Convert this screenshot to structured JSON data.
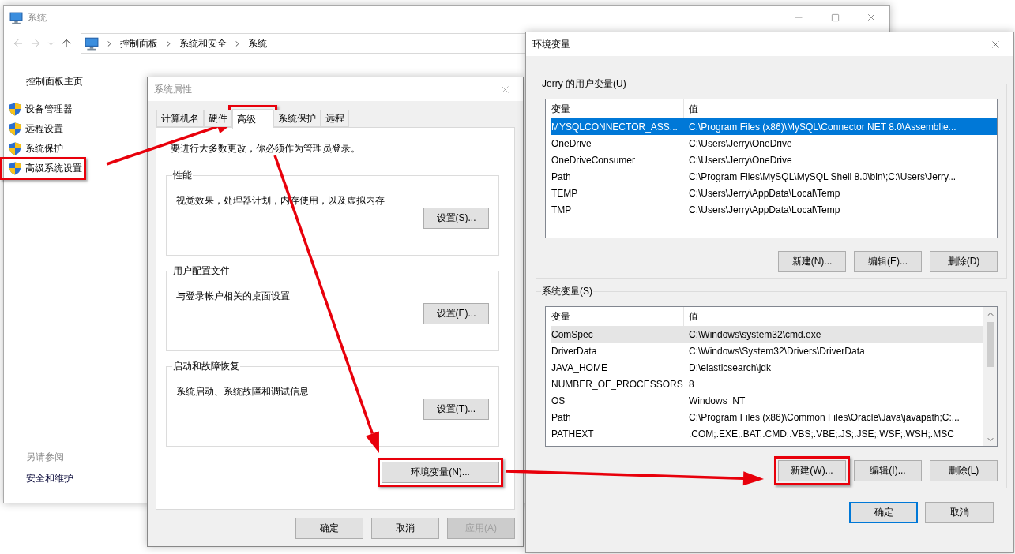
{
  "system_window": {
    "title": "系统",
    "active": false,
    "breadcrumb": [
      "控制面板",
      "系统和安全",
      "系统"
    ],
    "sidebar": {
      "home": "控制面板主页",
      "links": [
        {
          "label": "设备管理器",
          "highlighted": false
        },
        {
          "label": "远程设置",
          "highlighted": false
        },
        {
          "label": "系统保护",
          "highlighted": false
        },
        {
          "label": "高级系统设置",
          "highlighted": true
        }
      ],
      "see_also_heading": "另请参阅",
      "see_also": [
        "安全和维护"
      ]
    }
  },
  "system_properties": {
    "title": "系统属性",
    "active": false,
    "tabs": [
      {
        "label": "计算机名",
        "selected": false,
        "highlighted": false
      },
      {
        "label": "硬件",
        "selected": false,
        "highlighted": false
      },
      {
        "label": "高级",
        "selected": true,
        "highlighted": true
      },
      {
        "label": "系统保护",
        "selected": false,
        "highlighted": false
      },
      {
        "label": "远程",
        "selected": false,
        "highlighted": false
      }
    ],
    "notice": "要进行大多数更改，你必须作为管理员登录。",
    "groups": [
      {
        "title": "性能",
        "description": "视觉效果，处理器计划，内存使用，以及虚拟内存",
        "button": "设置(S)..."
      },
      {
        "title": "用户配置文件",
        "description": "与登录帐户相关的桌面设置",
        "button": "设置(E)..."
      },
      {
        "title": "启动和故障恢复",
        "description": "系统启动、系统故障和调试信息",
        "button": "设置(T)..."
      }
    ],
    "env_button": {
      "label": "环境变量(N)...",
      "highlighted": true
    },
    "buttons": [
      {
        "label": "确定",
        "disabled": false
      },
      {
        "label": "取消",
        "disabled": false
      },
      {
        "label": "应用(A)",
        "disabled": true
      }
    ]
  },
  "environment_variables": {
    "title": "环境变量",
    "active": true,
    "sections": [
      {
        "title": "Jerry 的用户变量(U)",
        "columns": [
          "变量",
          "值"
        ],
        "focused": true,
        "scrollable": false,
        "rows": [
          {
            "name": "MYSQLCONNECTOR_ASS...",
            "value": "C:\\Program Files (x86)\\MySQL\\Connector NET 8.0\\Assemblie...",
            "selected": true
          },
          {
            "name": "OneDrive",
            "value": "C:\\Users\\Jerry\\OneDrive",
            "selected": false
          },
          {
            "name": "OneDriveConsumer",
            "value": "C:\\Users\\Jerry\\OneDrive",
            "selected": false
          },
          {
            "name": "Path",
            "value": "C:\\Program Files\\MySQL\\MySQL Shell 8.0\\bin\\;C:\\Users\\Jerry...",
            "selected": false
          },
          {
            "name": "TEMP",
            "value": "C:\\Users\\Jerry\\AppData\\Local\\Temp",
            "selected": false
          },
          {
            "name": "TMP",
            "value": "C:\\Users\\Jerry\\AppData\\Local\\Temp",
            "selected": false
          }
        ],
        "buttons": [
          {
            "label": "新建(N)...",
            "highlighted": false
          },
          {
            "label": "编辑(E)...",
            "highlighted": false
          },
          {
            "label": "删除(D)",
            "highlighted": false
          }
        ]
      },
      {
        "title": "系统变量(S)",
        "columns": [
          "变量",
          "值"
        ],
        "focused": false,
        "scrollable": true,
        "rows": [
          {
            "name": "ComSpec",
            "value": "C:\\Windows\\system32\\cmd.exe",
            "selected": true
          },
          {
            "name": "DriverData",
            "value": "C:\\Windows\\System32\\Drivers\\DriverData",
            "selected": false
          },
          {
            "name": "JAVA_HOME",
            "value": "D:\\elasticsearch\\jdk",
            "selected": false
          },
          {
            "name": "NUMBER_OF_PROCESSORS",
            "value": "8",
            "selected": false
          },
          {
            "name": "OS",
            "value": "Windows_NT",
            "selected": false
          },
          {
            "name": "Path",
            "value": "C:\\Program Files (x86)\\Common Files\\Oracle\\Java\\javapath;C:...",
            "selected": false
          },
          {
            "name": "PATHEXT",
            "value": ".COM;.EXE;.BAT;.CMD;.VBS;.VBE;.JS;.JSE;.WSF;.WSH;.MSC",
            "selected": false
          }
        ],
        "buttons": [
          {
            "label": "新建(W)...",
            "highlighted": true
          },
          {
            "label": "编辑(I)...",
            "highlighted": false
          },
          {
            "label": "删除(L)",
            "highlighted": false
          }
        ]
      }
    ],
    "buttons": [
      {
        "label": "确定",
        "default": true
      },
      {
        "label": "取消",
        "default": false
      }
    ]
  }
}
